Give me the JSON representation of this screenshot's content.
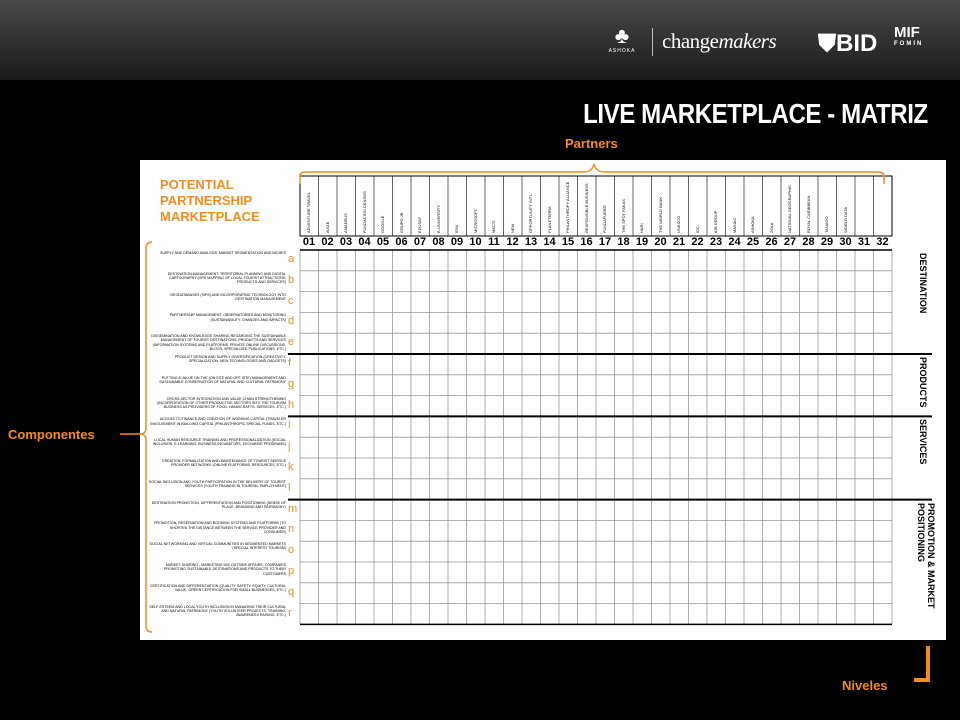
{
  "header": {
    "ashoka_logo": "ASHOKA",
    "changemakers_logo": {
      "plain": "change",
      "italic": "makers"
    },
    "bid_logo": "BID",
    "mif_logo": {
      "main": "MIF",
      "sub": "FOMIN"
    },
    "title": "LIVE MARKETPLACE - MATRIZ"
  },
  "labels": {
    "partners": "Partners",
    "componentes": "Componentes",
    "niveles": "Niveles"
  },
  "matrix": {
    "heading": [
      "POTENTIAL",
      "PARTNERSHIP",
      "MARKETPLACE"
    ],
    "partners": [
      "ADVENTURE TRAVEL",
      "AVIZE",
      "AMADEUS",
      "FUNDACION CENSOS",
      "GOOGLE",
      "GRUPO JB",
      "EDUSAY",
      "E-UNIVERSITY",
      "IDW",
      "MICROSOFT",
      "MECTI",
      "NEW",
      "OPPORTUNITY INT'L",
      "PLANETERRA",
      "PHILANTHROPY ALLIANCE",
      "RESPONSIBLE BUSINESS",
      "FUNDAFUERO",
      "THE SPOT FAKAS",
      "HARI",
      "THE WORLD BANK",
      "UNESCO",
      "IDC",
      "IDB GROUP",
      "MASIAC",
      "ASHOKA",
      "ZOLA",
      "NATIONAL GEOGRAPHIC",
      "ROYAL CARIBBEAN",
      "TANAGO",
      "WORLD DATA",
      "",
      ""
    ],
    "column_numbers": [
      "01",
      "02",
      "03",
      "04",
      "05",
      "06",
      "07",
      "08",
      "09",
      "10",
      "11",
      "12",
      "13",
      "14",
      "15",
      "16",
      "17",
      "18",
      "19",
      "20",
      "21",
      "22",
      "23",
      "24",
      "25",
      "26",
      "27",
      "28",
      "29",
      "30",
      "31",
      "32"
    ],
    "rows": [
      {
        "letter": "a",
        "desc": "SUPPLY AND DEMAND ANALYSIS; MARKET SEGMENTATION AND NICHES"
      },
      {
        "letter": "b",
        "desc": "DESTINATION MANAGEMENT: TERRITORIAL PLANNING AND DIGITAL CARTOGRAPHY (GPS MAPPING OF LOCAL TOURIST ATTRACTIONS, PRODUCTS AND SERVICES)"
      },
      {
        "letter": "c",
        "desc": "GEODATABASES (SIPS) AND INCORPORATING TECHNOLOGY INTO DESTINATION MANAGEMENT"
      },
      {
        "letter": "d",
        "desc": "PARTNERSHIP MANAGEMENT, OBSERVATORIES AND MONITORING (SUSTAINABILITY, CHANGES AND IMPACTS)"
      },
      {
        "letter": "e",
        "desc": "DISSEMINATION AND KNOWLEDGE SHARING REGARDING THE SUSTAINABLE MANAGEMENT OF TOURIST DESTINATIONS, PRODUCTS AND SERVICES (INFORMATION SYSTEMS AND PLATFORMS, PRIVATE ONLINE DISCUSSIONS, BLOGS, SPECIALIZED PUBLICATIONS, ETC.)"
      },
      {
        "letter": "f",
        "desc": "PRODUCT DESIGN AND SUPPLY DIVERSIFICATION (CREATIVITY, SPECIALIZATION, NEW TECHNOLOGIES AND GADGETS)"
      },
      {
        "letter": "g",
        "desc": "PUTTING A VALUE ON THE (ON SITE AND OFF SITE) MANAGEMENT AND SUSTAINABLE CONSERVATION OF NATURAL AND CULTURAL PATRIMONY"
      },
      {
        "letter": "h",
        "desc": "CROSS-SECTOR INTEGRATION AND VALUE CHAIN STRENGTHENING (INCORPORATION OF OTHER PRODUCTIVE SECTORS INTO THE TOURISM BUSINESS AS PROVIDERS OF FOOD, HANDICRAFTS, SERVICES, ETC.)"
      },
      {
        "letter": "i",
        "desc": "ACCESS TO FINANCE AND CREATION OF WORKING CAPITAL (TRAVELER INVOLVEMENT IN BUILDING CAPITAL (PHILANTHROPIC SPECIAL FUNDS, ETC.)"
      },
      {
        "letter": "j",
        "desc": "LOCAL HUMAN RESOURCE TRAINING AND PROFESSIONALIZATION (SOCIAL INCLUSION, E-LEARNING, BUSINESS INCUBATORS, EXCHANGE PROGRAMS)"
      },
      {
        "letter": "k",
        "desc": "CREATION, FORMALIZATION AND MAINTENANCE OF TOURIST SERVICE PROVIDER NETWORKS (ONLINE PLATFORMS, RESOURCES, ETC.)"
      },
      {
        "letter": "l",
        "desc": "SOCIAL INCLUSION AND YOUTH PARTICIPATION IN THE DELIVERY OF TOURIST SERVICES (YOUTH TRAINING IN TOURISM, EMPLOYMENT)"
      },
      {
        "letter": "m",
        "desc": "DESTINATION PROMOTION, DIFFERENTIATION AND POSITIONING (SENSE OF PLACE, BRANDING AND PATRIMONY)"
      },
      {
        "letter": "n",
        "desc": "PROMOTION, RESERVATION AND BOOKING SYSTEMS AND PLATFORMS (TO SHORTEN THE DISTANCE BETWEEN THE SERVICE PROVIDER AND CONSUMER)"
      },
      {
        "letter": "o",
        "desc": "SOCIAL NETWORKING AND VIRTUAL COMMUNITIES IN SEGMENTED MARKETS (SPECIAL INTEREST TOURISM)"
      },
      {
        "letter": "p",
        "desc": "MARKET SHARING - MARKETING MIX OUTSIDE AFFAIRS; COMPANIES PROMOTING SUSTAINABLE DESTINATIONS AND PRODUCTS TO THEIR CUSTOMERS"
      },
      {
        "letter": "q",
        "desc": "CERTIFICATION AND DIFFERENTIATION (QUALITY SAFETY, EQUITY, CULTURAL VALUE, GREEN CERTIFICATION FOR SMALL BUSINESSES, ETC.)"
      },
      {
        "letter": "r",
        "desc": "SELF-ESTEEM AND LOCAL YOUTH INCLUSION IN MANAGING THEIR CULTURAL AND NATURAL PATRIMONY (YOUTH VOLUNTEER PROJECTS, TRAINING, AWARENESS RAISING, ETC.)"
      }
    ],
    "sections": [
      "DESTINATION",
      "PRODUCTS",
      "SERVICES",
      "PROMOTION & MARKET POSITIONING"
    ]
  },
  "colors": {
    "accent": "#f28c1e",
    "background": "#000000",
    "grid": "#999999"
  }
}
